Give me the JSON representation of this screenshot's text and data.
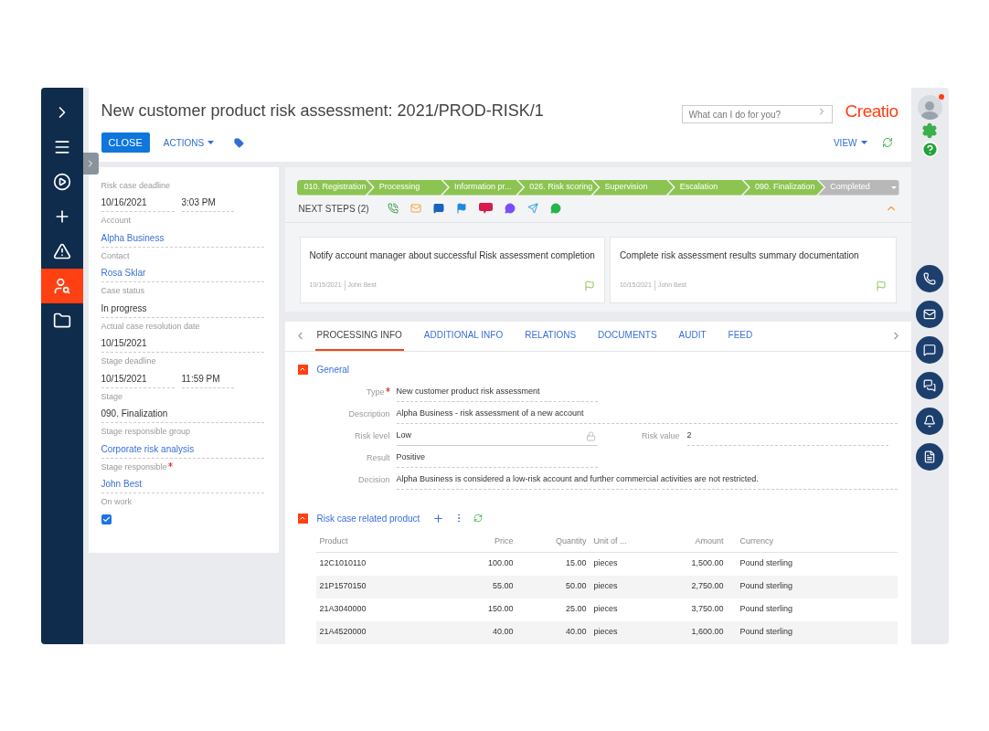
{
  "nav": [
    {
      "kind": "expand",
      "selected": false
    },
    {
      "kind": "menu",
      "selected": false
    },
    {
      "kind": "play",
      "selected": false
    },
    {
      "kind": "add",
      "selected": false
    },
    {
      "kind": "warning",
      "selected": false
    },
    {
      "kind": "agent",
      "selected": true
    },
    {
      "kind": "folder",
      "selected": false
    }
  ],
  "header": {
    "title": "New customer product risk assessment: 2021/PROD-RISK/1",
    "close": "CLOSE",
    "actions": "ACTIONS",
    "view": "VIEW",
    "search_placeholder": "What can I do for you?",
    "logo": "Creatio"
  },
  "profile": {
    "notification": true
  },
  "fields": [
    {
      "kind": "datetime",
      "label": "Risk case deadline",
      "value": "10/16/2021",
      "time": "3:03 PM",
      "required": false
    },
    {
      "kind": "link",
      "label": "Account",
      "value": "Alpha Business",
      "required": false
    },
    {
      "kind": "link",
      "label": "Contact",
      "value": "Rosa Sklar",
      "required": false
    },
    {
      "kind": "text",
      "label": "Case status",
      "value": "In progress",
      "required": false
    },
    {
      "kind": "text",
      "label": "Actual case resolution date",
      "value": "10/15/2021",
      "required": false
    },
    {
      "kind": "datetime",
      "label": "Stage deadline",
      "value": "10/15/2021",
      "time": "11:59 PM",
      "required": false
    },
    {
      "kind": "text",
      "label": "Stage",
      "value": "090. Finalization",
      "required": false
    },
    {
      "kind": "link",
      "label": "Stage responsible group",
      "value": "Corporate risk analysis",
      "required": false
    },
    {
      "kind": "link",
      "label": "Stage responsible",
      "value": "John Best",
      "required": true
    },
    {
      "kind": "checkbox",
      "label": "On work",
      "checked": true,
      "required": false
    }
  ],
  "stages": [
    {
      "label": "010. Registration",
      "reached": true
    },
    {
      "label": "Processing",
      "reached": true
    },
    {
      "label": "Information pr...",
      "reached": true
    },
    {
      "label": "026. Risk scoring",
      "reached": true
    },
    {
      "label": "Supervision",
      "reached": true
    },
    {
      "label": "Escalation",
      "reached": true
    },
    {
      "label": "090. Finalization",
      "reached": true
    },
    {
      "label": "Completed",
      "reached": false
    }
  ],
  "next_steps": {
    "title": "NEXT STEPS (2)",
    "cards": [
      {
        "text": "Notify account manager about successful Risk assessment completion",
        "date": "10/15/2021",
        "owner": "John Best"
      },
      {
        "text": "Complete risk assessment results summary documentation",
        "date": "10/15/2021",
        "owner": "John Best"
      }
    ]
  },
  "tabs": [
    {
      "label": "PROCESSING INFO",
      "selected": true
    },
    {
      "label": "ADDITIONAL INFO",
      "selected": false
    },
    {
      "label": "RELATIONS",
      "selected": false
    },
    {
      "label": "DOCUMENTS",
      "selected": false
    },
    {
      "label": "AUDIT",
      "selected": false
    },
    {
      "label": "FEED",
      "selected": false
    }
  ],
  "general": {
    "title": "General",
    "fields": [
      {
        "label": "Type",
        "value": "New customer product risk assessment",
        "required": true,
        "locked": false,
        "kind": "short"
      },
      {
        "label": "Description",
        "value": "Alpha Business - risk assessment of a new account",
        "required": false,
        "locked": false,
        "kind": "long"
      },
      {
        "label": "Risk level",
        "value": "Low",
        "required": false,
        "locked": true,
        "kind": "short",
        "side_label": "Risk value",
        "side_value": "2"
      },
      {
        "label": "Result",
        "value": "Positive",
        "required": false,
        "locked": false,
        "kind": "short"
      },
      {
        "label": "Decision",
        "value": "Alpha Business is considered a low-risk account and further commercial activities are not restricted.",
        "required": false,
        "locked": false,
        "kind": "long"
      }
    ]
  },
  "products": {
    "title": "Risk case related product",
    "columns": [
      "Product",
      "Price",
      "Quantity",
      "Unit of ...",
      "Amount",
      "Currency"
    ],
    "rows": [
      [
        "12C1010110",
        "100.00",
        "15.00",
        "pieces",
        "1,500.00",
        "Pound sterling"
      ],
      [
        "21P1570150",
        "55.00",
        "50.00",
        "pieces",
        "2,750.00",
        "Pound sterling"
      ],
      [
        "21A3040000",
        "150.00",
        "25.00",
        "pieces",
        "3,750.00",
        "Pound sterling"
      ],
      [
        "21A4520000",
        "40.00",
        "40.00",
        "pieces",
        "1,600.00",
        "Pound sterling"
      ]
    ]
  },
  "rail": [
    {
      "kind": "phone"
    },
    {
      "kind": "email"
    },
    {
      "kind": "chat"
    },
    {
      "kind": "chats"
    },
    {
      "kind": "bell"
    },
    {
      "kind": "document"
    }
  ]
}
